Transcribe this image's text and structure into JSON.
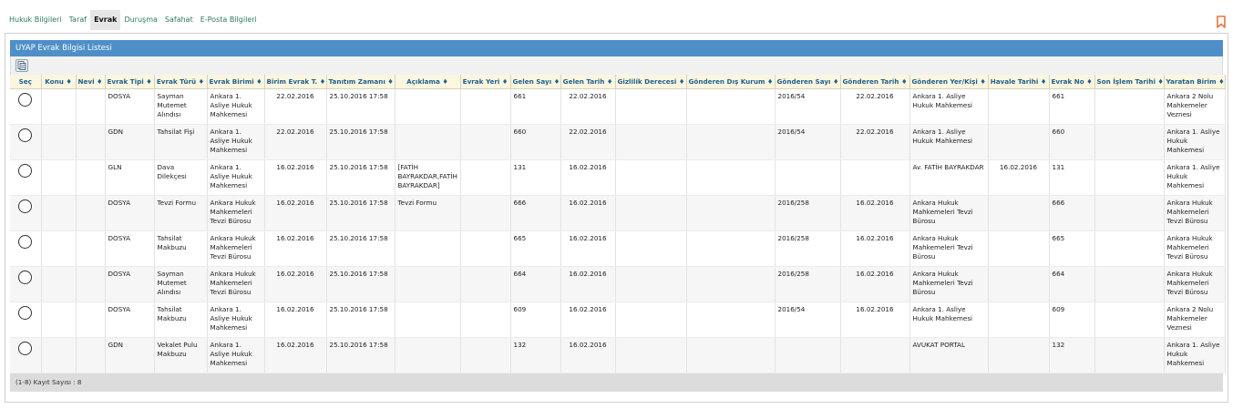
{
  "tabs": [
    {
      "label": "Hukuk Bilgileri"
    },
    {
      "label": "Taraf"
    },
    {
      "label": "Evrak"
    },
    {
      "label": "Duruşma"
    },
    {
      "label": "Safahat"
    },
    {
      "label": "E-Posta Bilgileri"
    }
  ],
  "active_tab": "Evrak",
  "panel": {
    "title": "UYAP Evrak Bilgisi Listesi"
  },
  "icons": {
    "bookmark": "bookmark-icon",
    "export": "export-icon",
    "select": "radio-button"
  },
  "colors": {
    "header_bar": "#4e8fc8",
    "tab_link": "#2e7a5c",
    "bookmark": "#e8743b",
    "column_header_bg": "#faf6e0",
    "column_header_text": "#1f5f8e"
  },
  "table": {
    "columns": [
      "Seç",
      "Konu ♦",
      "Nevi ♦",
      "Evrak Tipi ♦",
      "Evrak Türü ♦",
      "Evrak Birimi ♦",
      "Birim Evrak T. ♦",
      "Tanıtım Zamanı ♦",
      "Açıklama ♦",
      "Evrak Yeri ♦",
      "Gelen Sayı ♦",
      "Gelen Tarih ♦",
      "Gizlilik Derecesi ♦",
      "Gönderen Dış Kurum ♦",
      "Gönderen Sayı ♦",
      "Gönderen Tarih ♦",
      "Gönderen Yer/Kişi ♦",
      "Havale Tarihi ♦",
      "Evrak No ♦",
      "Son İşlem Tarihi ♦",
      "Yaratan Birim ♦"
    ],
    "rows": [
      [
        "",
        "",
        "",
        "DOSYA",
        "Sayman Mutemet Alındısı",
        "Ankara 1. Asliye Hukuk Mahkemesi",
        "22.02.2016",
        "25.10.2016 17:58",
        "",
        "",
        "661",
        "22.02.2016",
        "",
        "",
        "2016/54",
        "22.02.2016",
        "Ankara 1. Asliye Hukuk Mahkemesi",
        "",
        "661",
        "",
        "Ankara 2 Nolu Mahkemeler Veznesi"
      ],
      [
        "",
        "",
        "",
        "GDN",
        "Tahsilat Fişi",
        "Ankara 1. Asliye Hukuk Mahkemesi",
        "22.02.2016",
        "25.10.2016 17:58",
        "",
        "",
        "660",
        "22.02.2016",
        "",
        "",
        "2016/54",
        "22.02.2016",
        "Ankara 1. Asliye Hukuk Mahkemesi",
        "",
        "660",
        "",
        "Ankara 1. Asliye Hukuk Mahkemesi"
      ],
      [
        "",
        "",
        "",
        "GLN",
        "Dava Dilekçesi",
        "Ankara 1. Asliye Hukuk Mahkemesi",
        "16.02.2016",
        "25.10.2016 17:58",
        "[FATİH BAYRAKDAR,FATİH BAYRAKDAR]",
        "",
        "131",
        "16.02.2016",
        "",
        "",
        "",
        "",
        "Av. FATİH BAYRAKDAR",
        "16.02.2016",
        "131",
        "",
        "Ankara 1. Asliye Hukuk Mahkemesi"
      ],
      [
        "",
        "",
        "",
        "DOSYA",
        "Tevzi Formu",
        "Ankara Hukuk Mahkemeleri Tevzi Bürosu",
        "16.02.2016",
        "25.10.2016 17:58",
        "Tevzi Formu",
        "",
        "666",
        "16.02.2016",
        "",
        "",
        "2016/258",
        "16.02.2016",
        "Ankara Hukuk Mahkemeleri Tevzi Bürosu",
        "",
        "666",
        "",
        "Ankara Hukuk Mahkemeleri Tevzi Bürosu"
      ],
      [
        "",
        "",
        "",
        "DOSYA",
        "Tahsilat Makbuzu",
        "Ankara Hukuk Mahkemeleri Tevzi Bürosu",
        "16.02.2016",
        "25.10.2016 17:58",
        "",
        "",
        "665",
        "16.02.2016",
        "",
        "",
        "2016/258",
        "16.02.2016",
        "Ankara Hukuk Mahkemeleri Tevzi Bürosu",
        "",
        "665",
        "",
        "Ankara Hukuk Mahkemeleri Tevzi Bürosu"
      ],
      [
        "",
        "",
        "",
        "DOSYA",
        "Sayman Mutemet Alındısı",
        "Ankara Hukuk Mahkemeleri Tevzi Bürosu",
        "16.02.2016",
        "25.10.2016 17:58",
        "",
        "",
        "664",
        "16.02.2016",
        "",
        "",
        "2016/258",
        "16.02.2016",
        "Ankara Hukuk Mahkemeleri Tevzi Bürosu",
        "",
        "664",
        "",
        "Ankara Hukuk Mahkemeleri Tevzi Bürosu"
      ],
      [
        "",
        "",
        "",
        "DOSYA",
        "Tahsilat Makbuzu",
        "Ankara 1. Asliye Hukuk Mahkemesi",
        "16.02.2016",
        "25.10.2016 17:58",
        "",
        "",
        "609",
        "16.02.2016",
        "",
        "",
        "2016/54",
        "16.02.2016",
        "Ankara 1. Asliye Hukuk Mahkemesi",
        "",
        "609",
        "",
        "Ankara 2 Nolu Mahkemeler Veznesi"
      ],
      [
        "",
        "",
        "",
        "GDN",
        "Vekalet Pulu Makbuzu",
        "Ankara 1. Asliye Hukuk Mahkemesi",
        "16.02.2016",
        "25.10.2016 17:58",
        "",
        "",
        "132",
        "16.02.2016",
        "",
        "",
        "",
        "",
        "AVUKAT PORTAL",
        "",
        "132",
        "",
        "Ankara 1. Asliye Hukuk Mahkemesi"
      ]
    ]
  },
  "footer": {
    "record_count": "(1-8) Kayıt Sayısı : 8"
  }
}
